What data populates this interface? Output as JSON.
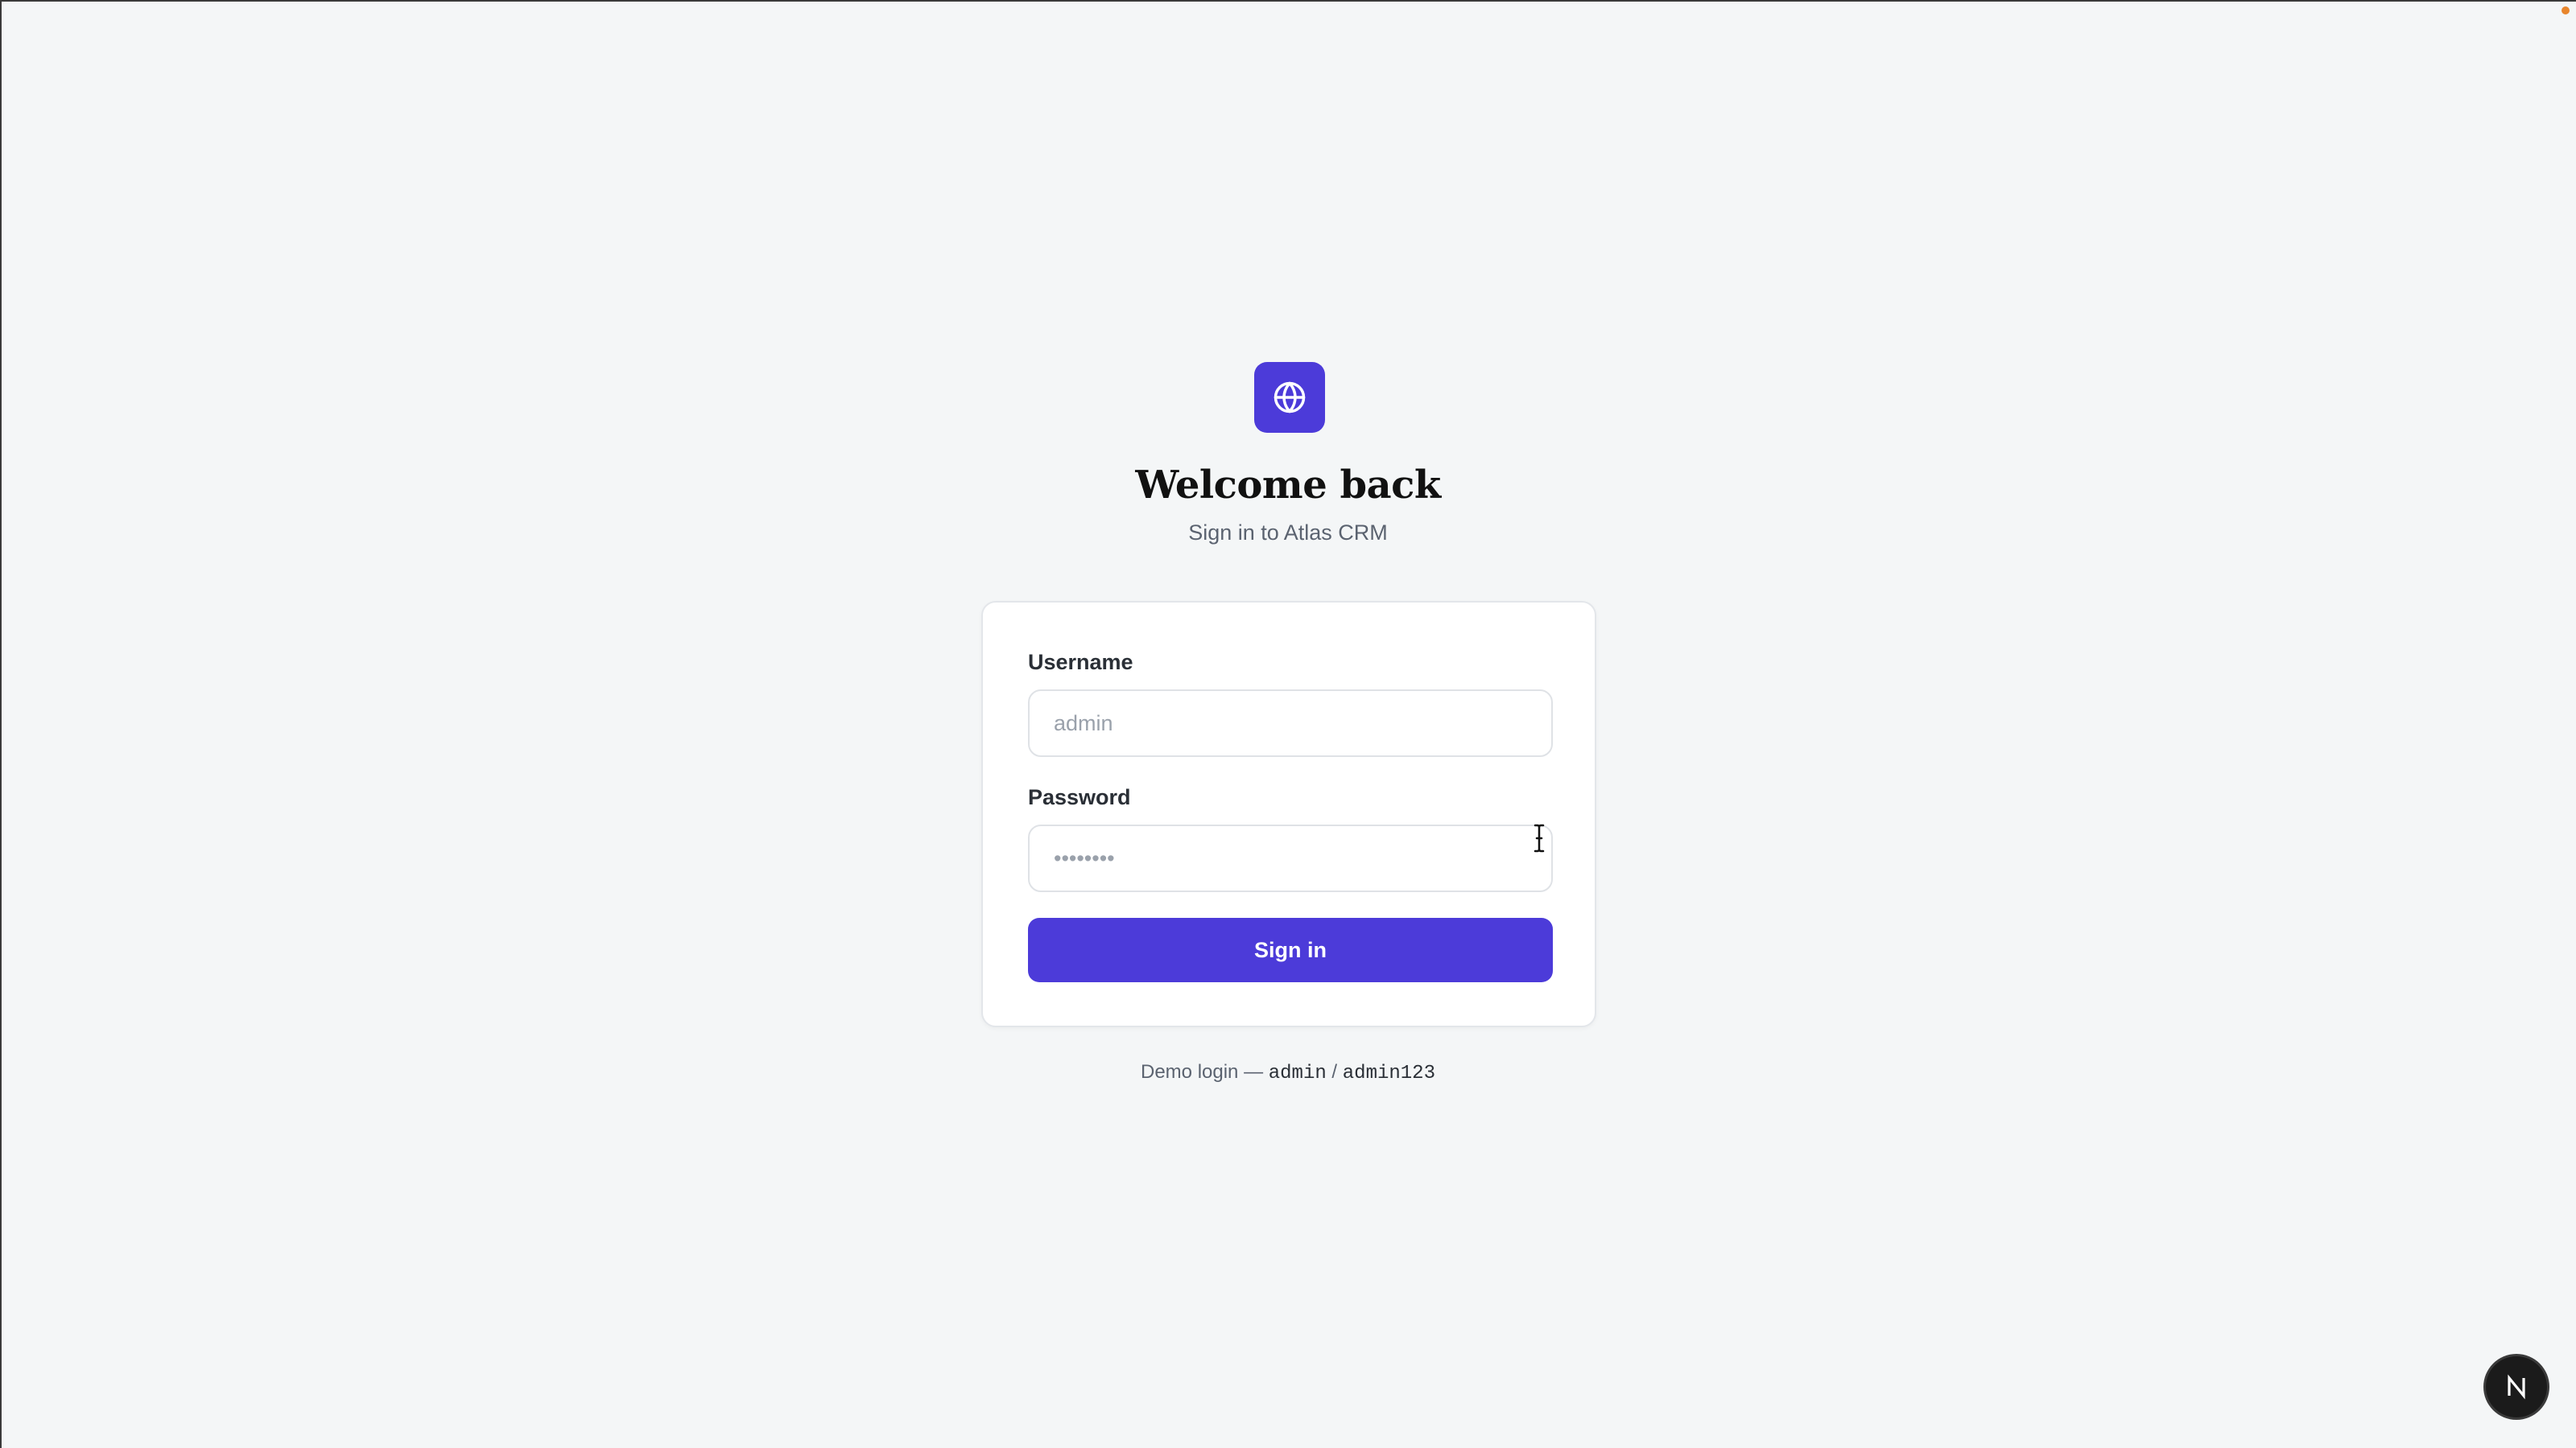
{
  "app": {
    "logo_icon": "globe-icon",
    "accent_color": "#4c3bd9"
  },
  "header": {
    "title": "Welcome back",
    "subtitle": "Sign in to Atlas CRM"
  },
  "form": {
    "username_label": "Username",
    "username_placeholder": "admin",
    "username_value": "",
    "password_label": "Password",
    "password_placeholder": "••••••••",
    "password_value": "",
    "submit_label": "Sign in"
  },
  "footer": {
    "demo_prefix": "Demo login —",
    "demo_username": "admin",
    "demo_separator": "/",
    "demo_password": "admin123"
  },
  "dev_badge": {
    "letter": "N",
    "icon": "nextjs-icon"
  },
  "status": {
    "indicator_color": "#e8862c"
  }
}
